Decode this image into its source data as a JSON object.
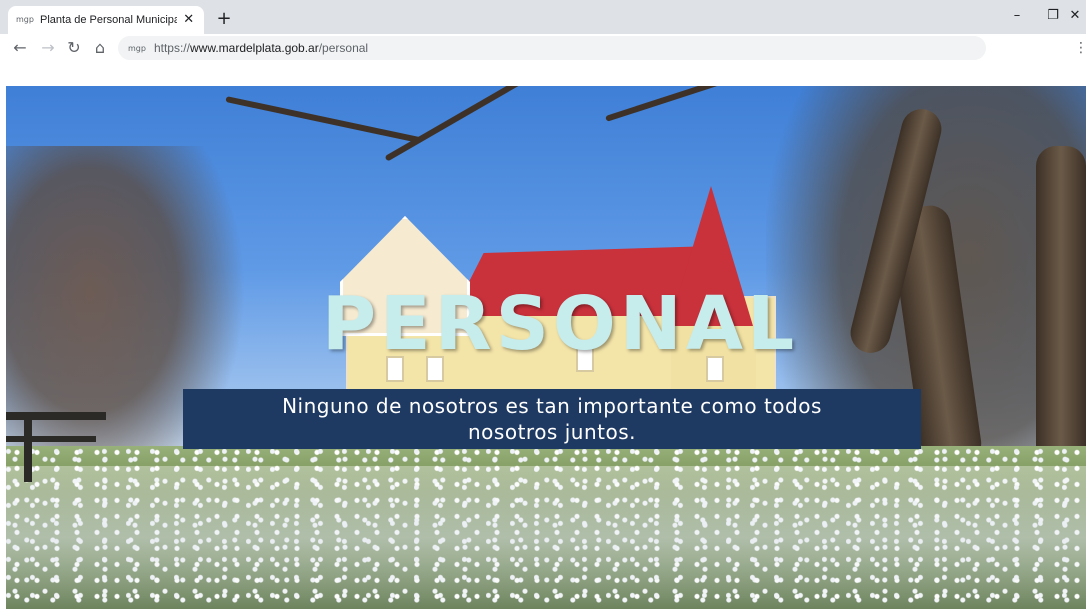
{
  "browser": {
    "tab_title": "Planta de Personal Municipal | Sit",
    "tab_favicon": "mgp",
    "new_tab_label": "+",
    "url_scheme": "https://",
    "url_host": "www.mardelplata.gob.ar",
    "url_path": "/personal",
    "window_controls": {
      "minimize": "–",
      "restore": "❐",
      "close": "✕"
    },
    "icons": [
      "back-arrow-icon",
      "forward-arrow-icon",
      "reload-icon",
      "home-icon",
      "menu-kebab-icon"
    ]
  },
  "hero": {
    "title": "PERSONAL",
    "tagline": "Ninguno de nosotros es tan importante como todos nosotros juntos.",
    "colors": {
      "title": "#c7ecec",
      "tagline_box": "#1e3a63",
      "tagline_text": "#ffffff"
    }
  }
}
